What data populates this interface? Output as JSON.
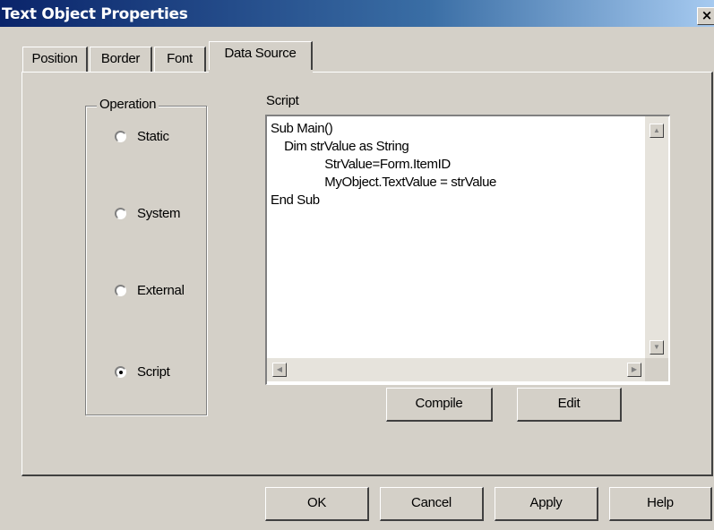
{
  "window": {
    "title": "Text Object Properties",
    "close_glyph": "×"
  },
  "tabs": [
    {
      "label": "Position"
    },
    {
      "label": "Border"
    },
    {
      "label": "Font"
    },
    {
      "label": "Data Source",
      "active": true
    }
  ],
  "operation": {
    "legend": "Operation",
    "options": [
      {
        "label": "Static",
        "selected": false
      },
      {
        "label": "System",
        "selected": false
      },
      {
        "label": "External",
        "selected": false
      },
      {
        "label": "Script",
        "selected": true
      }
    ]
  },
  "script": {
    "label": "Script",
    "code": "Sub Main()\n    Dim strValue as String\n                StrValue=Form.ItemID\n                MyObject.TextValue = strValue\nEnd Sub"
  },
  "script_buttons": {
    "compile": "Compile",
    "edit": "Edit"
  },
  "footer_buttons": {
    "ok": "OK",
    "cancel": "Cancel",
    "apply": "Apply",
    "help": "Help"
  },
  "icons": {
    "close": "close-icon",
    "scroll_up": "scroll-up-icon",
    "scroll_down": "scroll-down-icon",
    "scroll_left": "scroll-left-icon",
    "scroll_right": "scroll-right-icon"
  }
}
